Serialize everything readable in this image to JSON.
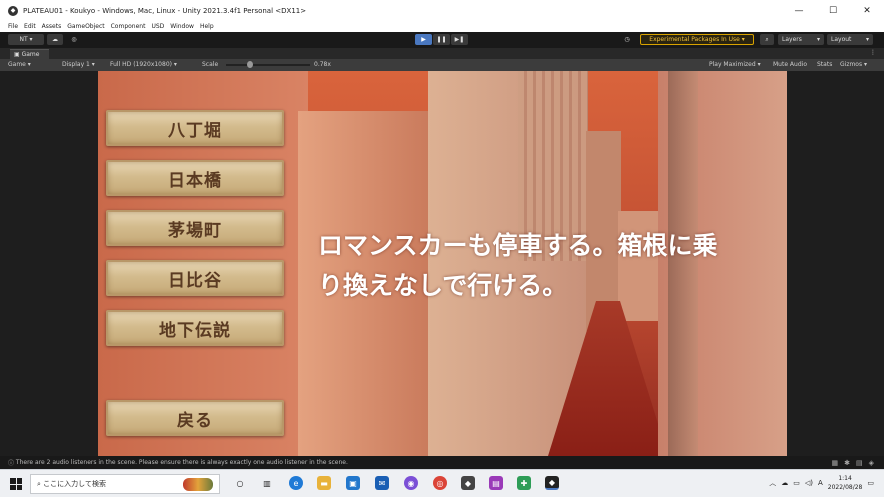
{
  "window": {
    "title": "PLATEAU01 - Koukyo - Windows, Mac, Linux - Unity 2021.3.4f1 Personal <DX11>",
    "minimize": "—",
    "maximize": "☐",
    "close": "✕"
  },
  "menu": [
    "File",
    "Edit",
    "Assets",
    "GameObject",
    "Component",
    "USD",
    "Window",
    "Help"
  ],
  "toolbar": {
    "account": "NT ▾",
    "experimental_packages": "Experimental Packages In Use ▾",
    "layers": "Layers",
    "layout": "Layout"
  },
  "game_tab": {
    "tab_label": "Game",
    "view_dropdown": "Game",
    "display": "Display 1",
    "resolution": "Full HD (1920x1080)",
    "scale_label": "Scale",
    "scale_value": "0.78x",
    "scale_fraction": 0.28,
    "play_maximized": "Play Maximized",
    "mute_audio": "Mute Audio",
    "stats": "Stats",
    "gizmos": "Gizmos"
  },
  "game": {
    "menu_buttons": [
      "八丁堀",
      "日本橋",
      "茅場町",
      "日比谷",
      "地下伝説"
    ],
    "back_button": "戻る",
    "caption_line1": "ロマンスカーも停車する。箱根に乗",
    "caption_line2": "り換えなしで行ける。"
  },
  "status": {
    "message": "There are 2 audio listeners in the scene. Please ensure there is always exactly one audio listener in the scene."
  },
  "taskbar": {
    "search_placeholder": "ここに入力して検索",
    "time": "1:14",
    "date": "2022/08/28",
    "ime": "A"
  },
  "colors": {
    "accent_play": "#4a78c0",
    "experimental": "#f2c038",
    "sky": "#d9643c",
    "button_wood": "#d3bb8d",
    "button_text": "#5a3a22"
  }
}
